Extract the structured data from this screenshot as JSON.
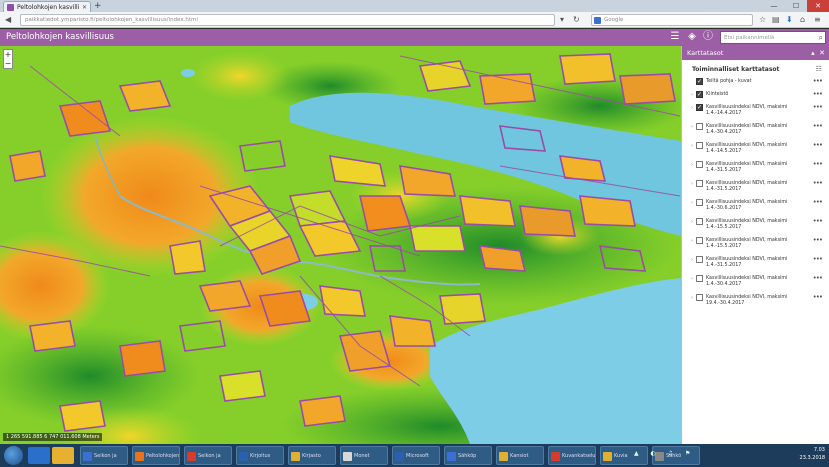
{
  "browser": {
    "tab_title": "Peltolohkojen kasvillisuus",
    "url": "paikkatiedot.ymparisto.fi/peltolohkojen_kasvillisuus/index.html",
    "search_placeholder": "Google"
  },
  "app": {
    "title": "Peltolohkojen kasvillisuus",
    "address_placeholder": "Etsi paikannimellä"
  },
  "map": {
    "zoom_in": "+",
    "zoom_out": "−",
    "coords": "1 265 591.885 6 747 011.608 Meters"
  },
  "panel": {
    "header_title": "Karttatasot",
    "operational_title": "Toiminnalliset karttatasot",
    "layers": [
      {
        "label": "Teiltä pohja - kuvat",
        "checked": true,
        "expandable": false
      },
      {
        "label": "Kiinteistö",
        "checked": true,
        "expandable": true
      },
      {
        "label": "Kasvillisuusindeksi NDVI, maksimi 1.4.-14.4.2017",
        "checked": true,
        "expandable": true
      },
      {
        "label": "Kasvillisuusindeksi NDVI, maksimi 1.4.-30.4.2017",
        "checked": false,
        "expandable": true
      },
      {
        "label": "Kasvillisuusindeksi NDVI, maksimi 1.4.-14.5.2017",
        "checked": false,
        "expandable": true
      },
      {
        "label": "Kasvillisuusindeksi NDVI, maksimi 1.4.-31.5.2017",
        "checked": false,
        "expandable": true
      },
      {
        "label": "Kasvillisuusindeksi NDVI, maksimi 1.4.-31.5.2017",
        "checked": false,
        "expandable": true
      },
      {
        "label": "Kasvillisuusindeksi NDVI, maksimi 1.4.-30.6.2017",
        "checked": false,
        "expandable": true
      },
      {
        "label": "Kasvillisuusindeksi NDVI, maksimi 1.4.-15.5.2017",
        "checked": false,
        "expandable": true
      },
      {
        "label": "Kasvillisuusindeksi NDVI, maksimi 1.4.-15.5.2017",
        "checked": false,
        "expandable": true
      },
      {
        "label": "Kasvillisuusindeksi NDVI, maksimi 1.4.-31.5.2017",
        "checked": false,
        "expandable": true
      },
      {
        "label": "Kasvillisuusindeksi NDVI, maksimi 1.4.-30.4.2017",
        "checked": false,
        "expandable": true
      },
      {
        "label": "Kasvillisuusindeksi NDVI, maksimi 19.4.-30.4.2017",
        "checked": false,
        "expandable": true
      }
    ]
  },
  "taskbar": {
    "tasks": [
      {
        "label": "Seikon ja",
        "color": "#3b6fd4"
      },
      {
        "label": "Peltolohkojen",
        "color": "#e8731c"
      },
      {
        "label": "Seikon ja",
        "color": "#d63b2b"
      },
      {
        "label": "Kirjoitus",
        "color": "#2b5fb0"
      },
      {
        "label": "Kirjasto",
        "color": "#e0b030"
      },
      {
        "label": "Monet",
        "color": "#d8d8d8"
      },
      {
        "label": "Microsoft",
        "color": "#2b5fb0"
      },
      {
        "label": "Sähköp",
        "color": "#3b6fd4"
      },
      {
        "label": "Kansiot",
        "color": "#e0b030"
      },
      {
        "label": "Kuvankatseluohjelma",
        "color": "#d63b2b"
      },
      {
        "label": "Kuvia",
        "color": "#e0b030"
      },
      {
        "label": "Sähkö",
        "color": "#888888"
      }
    ],
    "time": "7.03",
    "date": "23.3.2018"
  }
}
